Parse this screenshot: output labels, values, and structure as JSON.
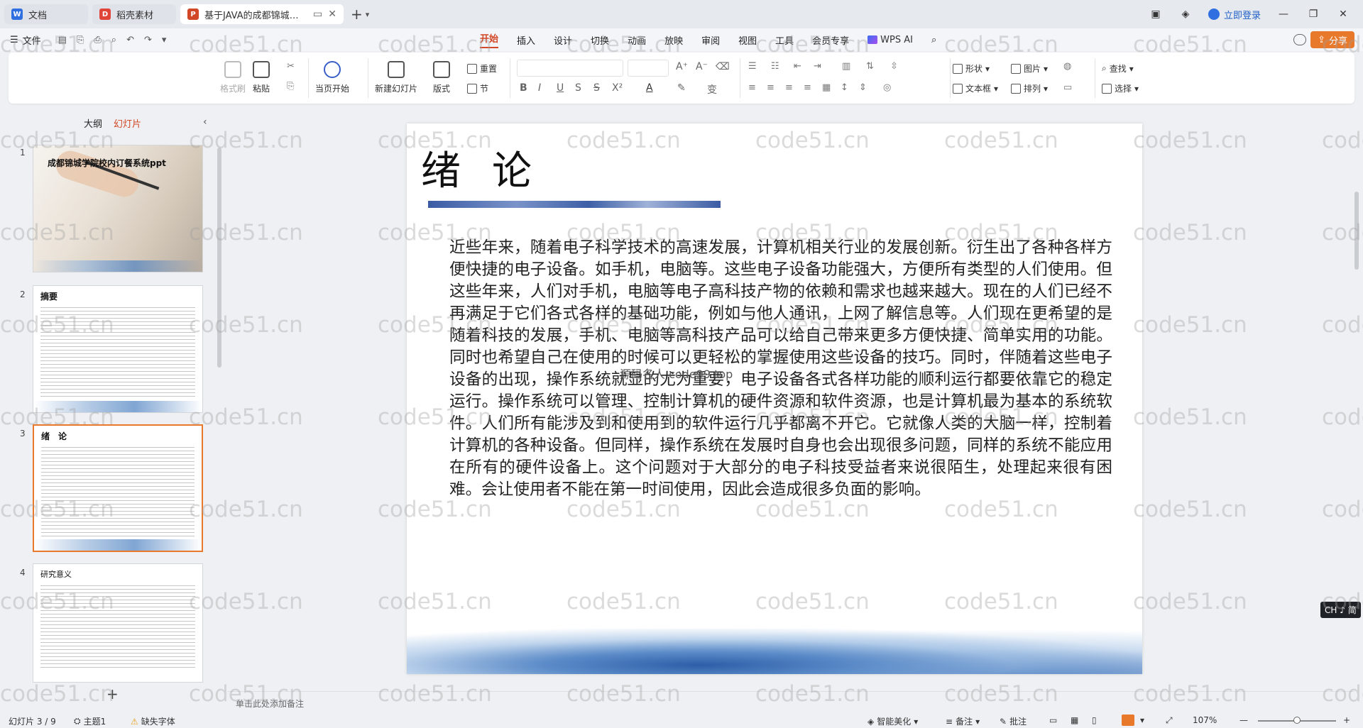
{
  "tabs": [
    {
      "label": "文档",
      "color": "#2f6fe0",
      "icon": "docs-icon"
    },
    {
      "label": "稻壳素材",
      "color": "#e0453a",
      "icon": "docer-icon"
    },
    {
      "label": "基于JAVA的成都锦城学院校",
      "color": "#d24726",
      "icon": "ppt-icon"
    }
  ],
  "titlebar": {
    "login_label": "立即登录"
  },
  "menubar": {
    "file_label": "文件",
    "items": [
      "开始",
      "插入",
      "设计",
      "切换",
      "动画",
      "放映",
      "审阅",
      "视图",
      "工具",
      "会员专享"
    ],
    "active": "开始",
    "wps_ai_label": "WPS AI",
    "share_label": "分享"
  },
  "ribbon": {
    "format_brush": "格式刷",
    "paste": "粘贴",
    "from_current": "当页开始",
    "new_slide": "新建幻灯片",
    "layout": "版式",
    "reset": "重置",
    "section": "节",
    "shape": "形状",
    "picture": "图片",
    "textbox": "文本框",
    "arrange": "排列",
    "find": "查找",
    "select": "选择"
  },
  "left_panel": {
    "tab_outline": "大纲",
    "tab_slides": "幻灯片",
    "thumbnails": [
      {
        "num": "1",
        "title": "成都锦城学院校内订餐系统ppt"
      },
      {
        "num": "2",
        "title": "摘要"
      },
      {
        "num": "3",
        "title": "绪　论"
      },
      {
        "num": "4",
        "title": "研究意义"
      }
    ]
  },
  "slide": {
    "title": "绪论",
    "body": "近些年来，随着电子科学技术的高速发展，计算机相关行业的发展创新。衍生出了各种各样方便快捷的电子设备。如手机，电脑等。这些电子设备功能强大，方便所有类型的人们使用。但这些年来，人们对手机，电脑等电子高科技产物的依赖和需求也越来越大。现在的人们已经不再满足于它们各式各样的基础功能，例如与他人通讯，上网了解信息等。人们现在更希望的是随着科技的发展，手机、电脑等高科技产品可以给自己带来更多方便快捷、简单实用的功能。同时也希望自己在使用的时候可以更轻松的掌握使用这些设备的技巧。同时，伴随着这些电子设备的出现，操作系统就显的尤为重要，电子设备各式各样功能的顺利运行都要依靠它的稳定运行。操作系统可以管理、控制计算机的硬件资源和软件资源，也是计算机最为基本的系统软件。人们所有能涉及到和使用到的软件运行几乎都离不开它。它就像人类的大脑一样，控制着计算机的各种设备。但同样，操作系统在发展时自身也会出现很多问题，同样的系统不能应用在所有的硬件设备上。这个问题对于大部分的电子科技受益者来说很陌生，处理起来很有困难。会让使用者不能在第一时间使用，因此会造成很多负面的影响。",
    "watermark": "源码名人 code99.top"
  },
  "notes_placeholder": "单击此处添加备注",
  "input_badge": "CH ♪ 简",
  "statusbar": {
    "slide_counter": "幻灯片 3 / 9",
    "theme": "主题1",
    "missing_font": "缺失字体",
    "smart_beautify": "智能美化",
    "notes": "备注",
    "comments": "批注",
    "zoom": "107%"
  },
  "watermark_text": "code51.cn"
}
